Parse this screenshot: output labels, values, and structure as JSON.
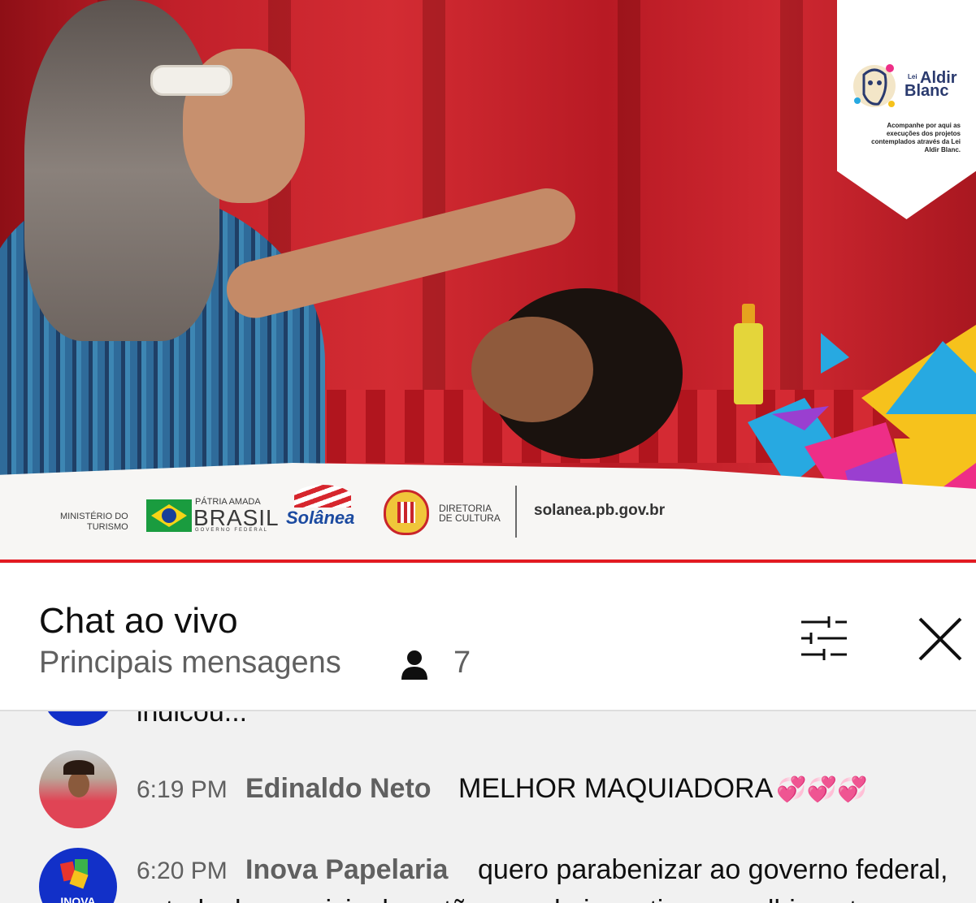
{
  "video": {
    "sponsors": {
      "ministerio": "MINISTÉRIO DO",
      "turismo": "TURISMO",
      "patria": "PÁTRIA AMADA",
      "brasil": "BRASIL",
      "governo": "GOVERNO FEDERAL",
      "solanea": "Solânea",
      "diretoria": "DIRETORIA",
      "cultura": "DE CULTURA",
      "site": "solanea.pb.gov.br"
    },
    "aldir": {
      "lei": "Lei",
      "title_line1": "Aldir",
      "title_line2": "Blanc",
      "caption": "Acompanhe por aqui as execuções dos projetos contemplados através da Lei Aldir Blanc."
    }
  },
  "chat": {
    "title": "Chat ao vivo",
    "mode": "Principais mensagens",
    "viewer_count": "7",
    "filter_icon": "sliders-icon",
    "close_icon": "close-icon"
  },
  "messages": [
    {
      "partial_text": "indicou..."
    },
    {
      "time": "6:19 PM",
      "author": "Edinaldo Neto",
      "text": "MELHOR MAQUIADORA",
      "emoji": "💞💞💞"
    },
    {
      "time": "6:20 PM",
      "author": "Inova Papelaria",
      "text": "quero parabenizar ao governo federal,",
      "text2": "estadual e municipal por tão grande incentivo e acolhimento a",
      "avatar_label": "INOVA"
    }
  ],
  "colors": {
    "curtain": "#c1202a",
    "accent_red": "#e21b22",
    "text_primary": "#0f0f0f",
    "text_secondary": "#606060"
  }
}
